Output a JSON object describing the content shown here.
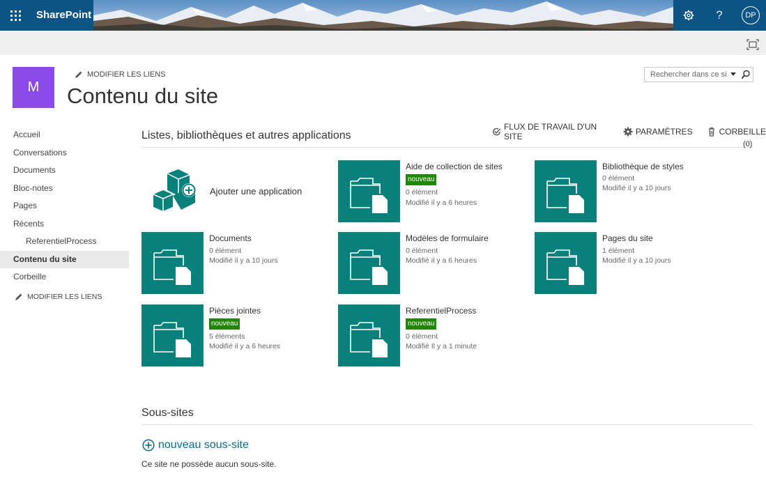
{
  "suite": {
    "brand": "SharePoint",
    "help_glyph": "?",
    "user_initials": "DP",
    "icons": [
      "waffle-icon",
      "gear-icon",
      "help-icon"
    ]
  },
  "site": {
    "logo_letter": "M",
    "logo_color": "#8a4be6",
    "edit_links": "MODIFIER LES LIENS",
    "page_title": "Contenu du site"
  },
  "search": {
    "placeholder": "Rechercher dans ce site"
  },
  "leftnav": {
    "items": [
      {
        "label": "Accueil",
        "level": 1,
        "selected": false
      },
      {
        "label": "Conversations",
        "level": 1,
        "selected": false
      },
      {
        "label": "Documents",
        "level": 1,
        "selected": false
      },
      {
        "label": "Bloc-notes",
        "level": 1,
        "selected": false
      },
      {
        "label": "Pages",
        "level": 1,
        "selected": false
      },
      {
        "label": "Récents",
        "level": 1,
        "selected": false
      },
      {
        "label": "ReferentielProcess",
        "level": 2,
        "selected": false
      },
      {
        "label": "Contenu du site",
        "level": 1,
        "selected": true
      },
      {
        "label": "Corbeille",
        "level": 1,
        "selected": false
      }
    ],
    "edit_links": "MODIFIER LES LIENS"
  },
  "main": {
    "section_title": "Listes, bibliothèques et autres applications",
    "actions": {
      "workflows": "FLUX DE TRAVAIL D'UN SITE",
      "settings": "PARAMÈTRES",
      "recycle": "CORBEILLE",
      "recycle_count": "(0)"
    },
    "add_app_label": "Ajouter une application",
    "tile_color": "#08807b",
    "badge_color": "#218605",
    "tiles": [
      {
        "title": "Aide de collection de sites",
        "badge": "nouveau",
        "count": "0 élément",
        "modified": "Modifié il y a 6 heures"
      },
      {
        "title": "Bibliothèque de styles",
        "badge": "",
        "count": "0 élément",
        "modified": "Modifié il y a 10 jours"
      },
      {
        "title": "Documents",
        "badge": "",
        "count": "0 élément",
        "modified": "Modifié il y a 10 jours"
      },
      {
        "title": "Modèles de formulaire",
        "badge": "",
        "count": "0 élément",
        "modified": "Modifié il y a 6 heures"
      },
      {
        "title": "Pages du site",
        "badge": "",
        "count": "1 élément",
        "modified": "Modifié il y a 10 jours"
      },
      {
        "title": "Pièces jointes",
        "badge": "nouveau",
        "count": "5 éléments",
        "modified": "Modifié il y a 6 heures"
      },
      {
        "title": "ReferentielProcess",
        "badge": "nouveau",
        "count": "0 élément",
        "modified": "Modifié Il y a 1 minute"
      }
    ],
    "subsites": {
      "title": "Sous-sites",
      "new_label": "nouveau sous-site",
      "empty_text": "Ce site ne possède aucun sous-site."
    }
  }
}
